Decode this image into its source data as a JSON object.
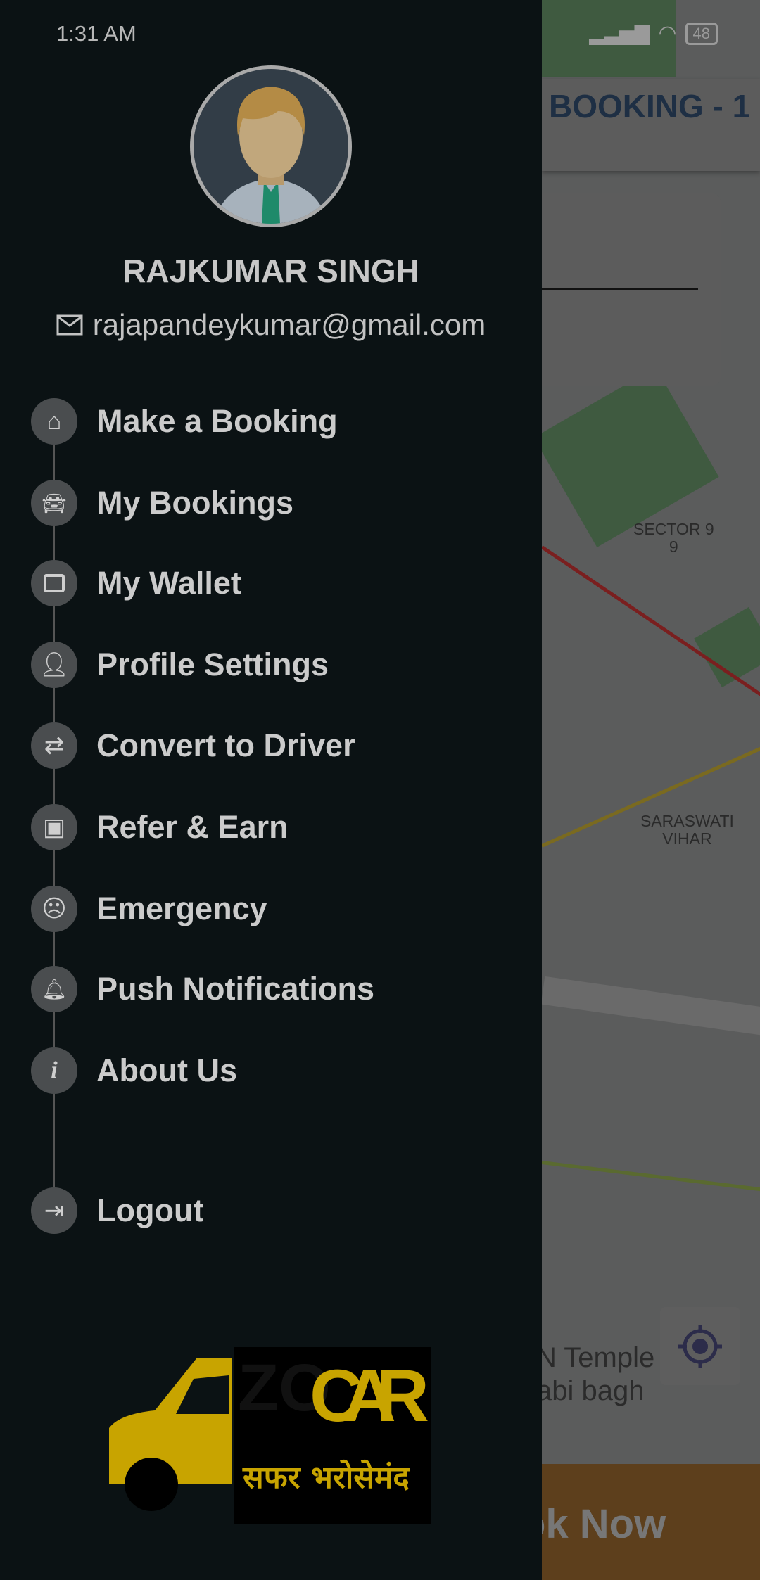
{
  "status_bar": {
    "time": "1:31 AM",
    "battery": "48"
  },
  "background": {
    "header_title": "BOOKING - 1",
    "map_labels": [
      "SECTOR 9\n9",
      "SARASWATI\nVIHAR",
      "N Temple",
      "abi bagh"
    ],
    "book_button": "ok Now"
  },
  "drawer": {
    "user_name": "RAJKUMAR SINGH",
    "email": "rajapandeykumar@gmail.com",
    "menu": [
      {
        "label": "Make a Booking",
        "icon": "home-icon"
      },
      {
        "label": "My Bookings",
        "icon": "car-icon"
      },
      {
        "label": "My Wallet",
        "icon": "wallet-icon"
      },
      {
        "label": "Profile Settings",
        "icon": "add-person-icon"
      },
      {
        "label": "Convert to Driver",
        "icon": "swap-icon"
      },
      {
        "label": "Refer & Earn",
        "icon": "money-icon"
      },
      {
        "label": "Emergency",
        "icon": "sad-face-icon"
      },
      {
        "label": "Push Notifications",
        "icon": "bell-icon"
      },
      {
        "label": "About Us",
        "icon": "info-icon"
      }
    ],
    "logout": {
      "label": "Logout",
      "icon": "logout-icon"
    },
    "logo": {
      "text": "ZOCAR",
      "tagline": "सफर भरोसेमंद"
    }
  },
  "colors": {
    "drawer_bg": "#0b1214",
    "logo_yellow": "#c8a400",
    "book_button": "#5d3f1c"
  }
}
